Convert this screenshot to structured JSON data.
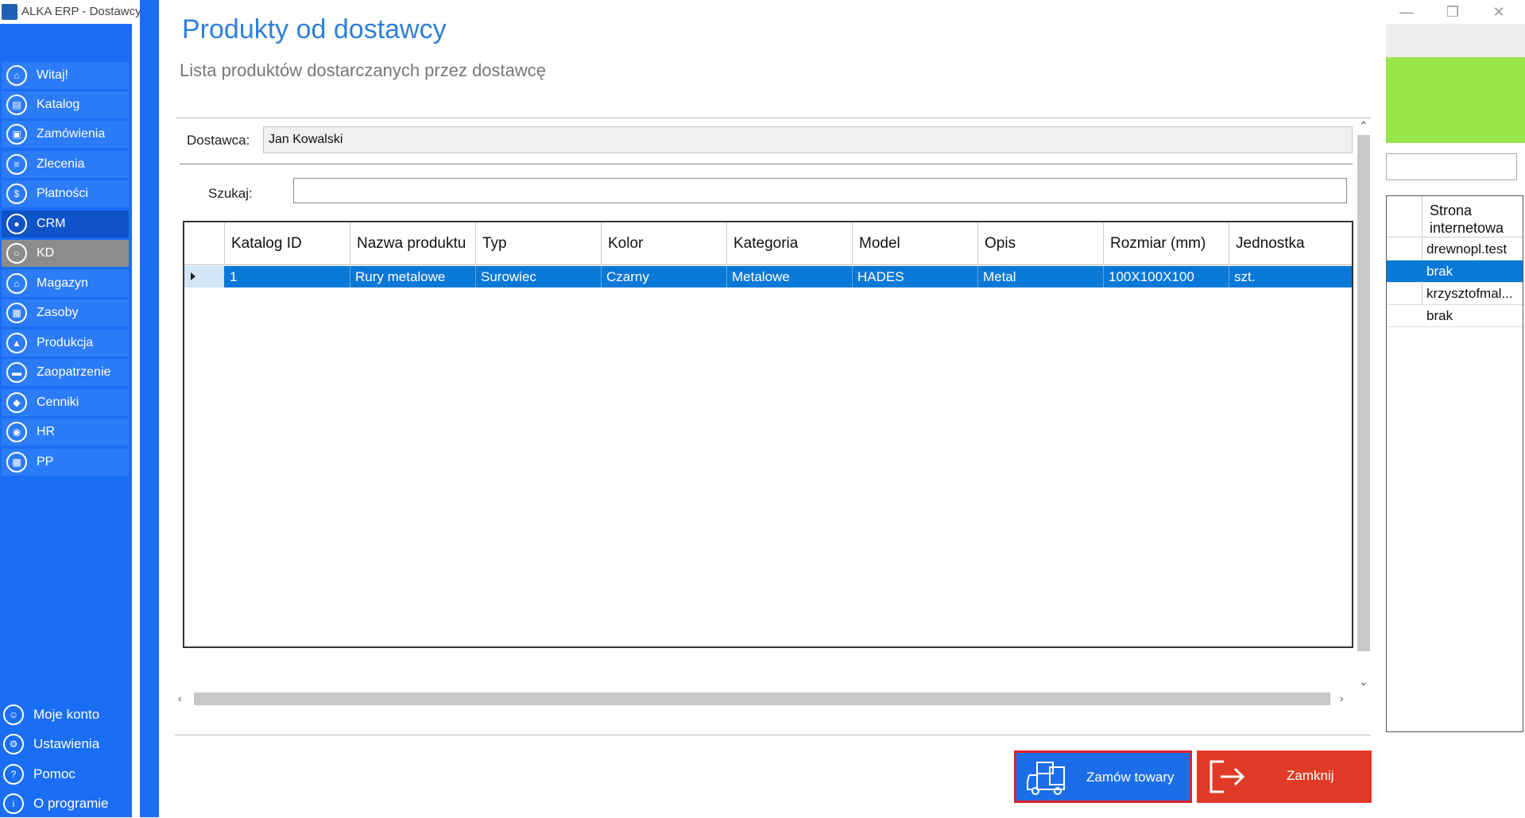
{
  "window": {
    "title": "ALKA ERP - Dostawcy",
    "controls": [
      "minimize-icon",
      "restore-icon",
      "close-icon"
    ]
  },
  "sidebar": {
    "items": [
      {
        "label": "Witaj!",
        "icon": "home-icon"
      },
      {
        "label": "Katalog",
        "icon": "book-icon"
      },
      {
        "label": "Zamówienia",
        "icon": "cart-icon"
      },
      {
        "label": "Zlecenia",
        "icon": "list-icon"
      },
      {
        "label": "Płatności",
        "icon": "dollar-icon"
      },
      {
        "label": "CRM",
        "icon": "crm-icon"
      },
      {
        "label": "KD",
        "icon": "lock-icon"
      },
      {
        "label": "Magazyn",
        "icon": "warehouse-icon"
      },
      {
        "label": "Zasoby",
        "icon": "calendar-icon"
      },
      {
        "label": "Produkcja",
        "icon": "factory-icon"
      },
      {
        "label": "Zaopatrzenie",
        "icon": "truck-icon"
      },
      {
        "label": "Cenniki",
        "icon": "tag-icon"
      },
      {
        "label": "HR",
        "icon": "people-icon"
      },
      {
        "label": "PP",
        "icon": "forklift-icon"
      }
    ],
    "bottom": [
      {
        "label": "Moje konto",
        "icon": "user-icon"
      },
      {
        "label": "Ustawienia",
        "icon": "gear-icon"
      },
      {
        "label": "Pomoc",
        "icon": "help-icon"
      },
      {
        "label": "O programie",
        "icon": "info-icon"
      }
    ]
  },
  "background_table": {
    "header": "Strona internetowa",
    "rows": [
      "drewnopl.test",
      "brak",
      "krzysztofmal...",
      "brak"
    ],
    "selected_row": 1
  },
  "dialog": {
    "title": "Produkty od dostawcy",
    "subtitle": "Lista produktów dostarczanych przez dostawcę",
    "supplier_label": "Dostawca:",
    "supplier_value": "Jan Kowalski",
    "search_label": "Szukaj:",
    "search_value": "",
    "grid": {
      "columns": [
        "Katalog ID",
        "Nazwa produktu",
        "Typ",
        "Kolor",
        "Kategoria",
        "Model",
        "Opis",
        "Rozmiar (mm)",
        "Jednostka"
      ],
      "rows": [
        [
          "1",
          "Rury metalowe",
          "Surowiec",
          "Czarny",
          "Metalowe",
          "HADES",
          "Metal",
          "100X100X100",
          "szt."
        ]
      ]
    },
    "order_button": "Zamów towary",
    "close_button": "Zamknij"
  },
  "colors": {
    "sidebar": "#1a6ef5",
    "accent_title": "#2f80d8",
    "selection": "#0a78d7",
    "order_button": "#1c6ee8",
    "close_button": "#e03b26",
    "highlight_border": "#e0202e",
    "green_banner": "#99e64a"
  }
}
